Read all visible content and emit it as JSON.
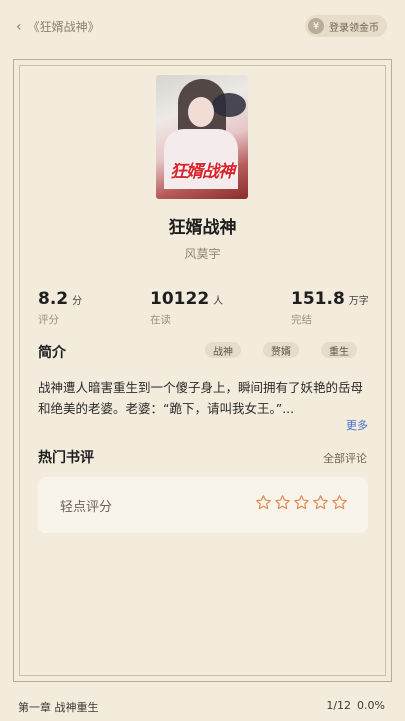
{
  "header": {
    "back_label": "《狂婿战神》",
    "coin_button_label": "登录领金币",
    "coin_symbol": "¥"
  },
  "book": {
    "cover_title_art": "狂婿战神",
    "title": "狂婿战神",
    "author": "风莫宇",
    "stats": [
      {
        "value": "8.2",
        "unit": "分",
        "label": "评分"
      },
      {
        "value": "10122",
        "unit": "人",
        "label": "在读"
      },
      {
        "value": "151.8",
        "unit": "万字",
        "label": "完结"
      }
    ]
  },
  "intro": {
    "title": "简介",
    "tags": [
      "战神",
      "赘婿",
      "重生"
    ],
    "text": "战神遭人暗害重生到一个傻子身上，瞬间拥有了妖艳的岳母和绝美的老婆。老婆：“跪下，请叫我女王。”...",
    "more_label": "更多"
  },
  "reviews": {
    "title": "热门书评",
    "all_label": "全部评论",
    "rate_label": "轻点评分",
    "stars_total": 5,
    "stars_filled": 0,
    "star_color": "#e0884a"
  },
  "footer": {
    "chapter": "第一章 战神重生",
    "page": "1/12",
    "progress": "0.0%"
  }
}
